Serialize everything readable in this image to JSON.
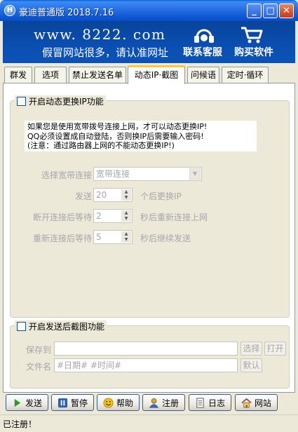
{
  "window": {
    "title": "豪迪普通版 2018.7.16"
  },
  "banner": {
    "url": "www. 8222. com",
    "slogan": "假冒网站很多，请认准网址",
    "contact_label": "联系客服",
    "buy_label": "购买软件"
  },
  "tabs": [
    {
      "label": "群发"
    },
    {
      "label": "选项"
    },
    {
      "label": "禁止发送名单"
    },
    {
      "label": "动态IP·截图"
    },
    {
      "label": "问候语"
    },
    {
      "label": "定时·循环"
    }
  ],
  "dynamic_ip": {
    "enable_label": "开启动态更换IP功能",
    "notice_lines": [
      "如果您是使用宽带拨号连接上网，才可以动态更换IP!",
      "QQ必须设置成自动登陆，否则换IP后需要输入密码!",
      "(注意：通过路由器上网的不能动态更换IP!)"
    ],
    "select_label": "选择宽带连接",
    "select_value": "宽带连接",
    "send_label": "发送",
    "send_value": "20",
    "send_suffix": "个后更换IP",
    "disconnect_label": "断开连接后等待",
    "disconnect_value": "2",
    "disconnect_suffix": "秒后重新连接上网",
    "reconnect_label": "重新连接后等待",
    "reconnect_value": "5",
    "reconnect_suffix": "秒后继续发送"
  },
  "screenshot": {
    "enable_label": "开启发送后截图功能",
    "save_label": "保存到",
    "save_value": "",
    "select_button": "选择",
    "open_button": "打开",
    "filename_label": "文件名",
    "filename_value": "#日期# #时间#",
    "default_button": "默认"
  },
  "toolbar": {
    "send": "发送",
    "pause": "暂停",
    "help": "帮助",
    "register": "注册",
    "log": "日志",
    "website": "网站"
  },
  "status": {
    "text": "已注册！"
  }
}
